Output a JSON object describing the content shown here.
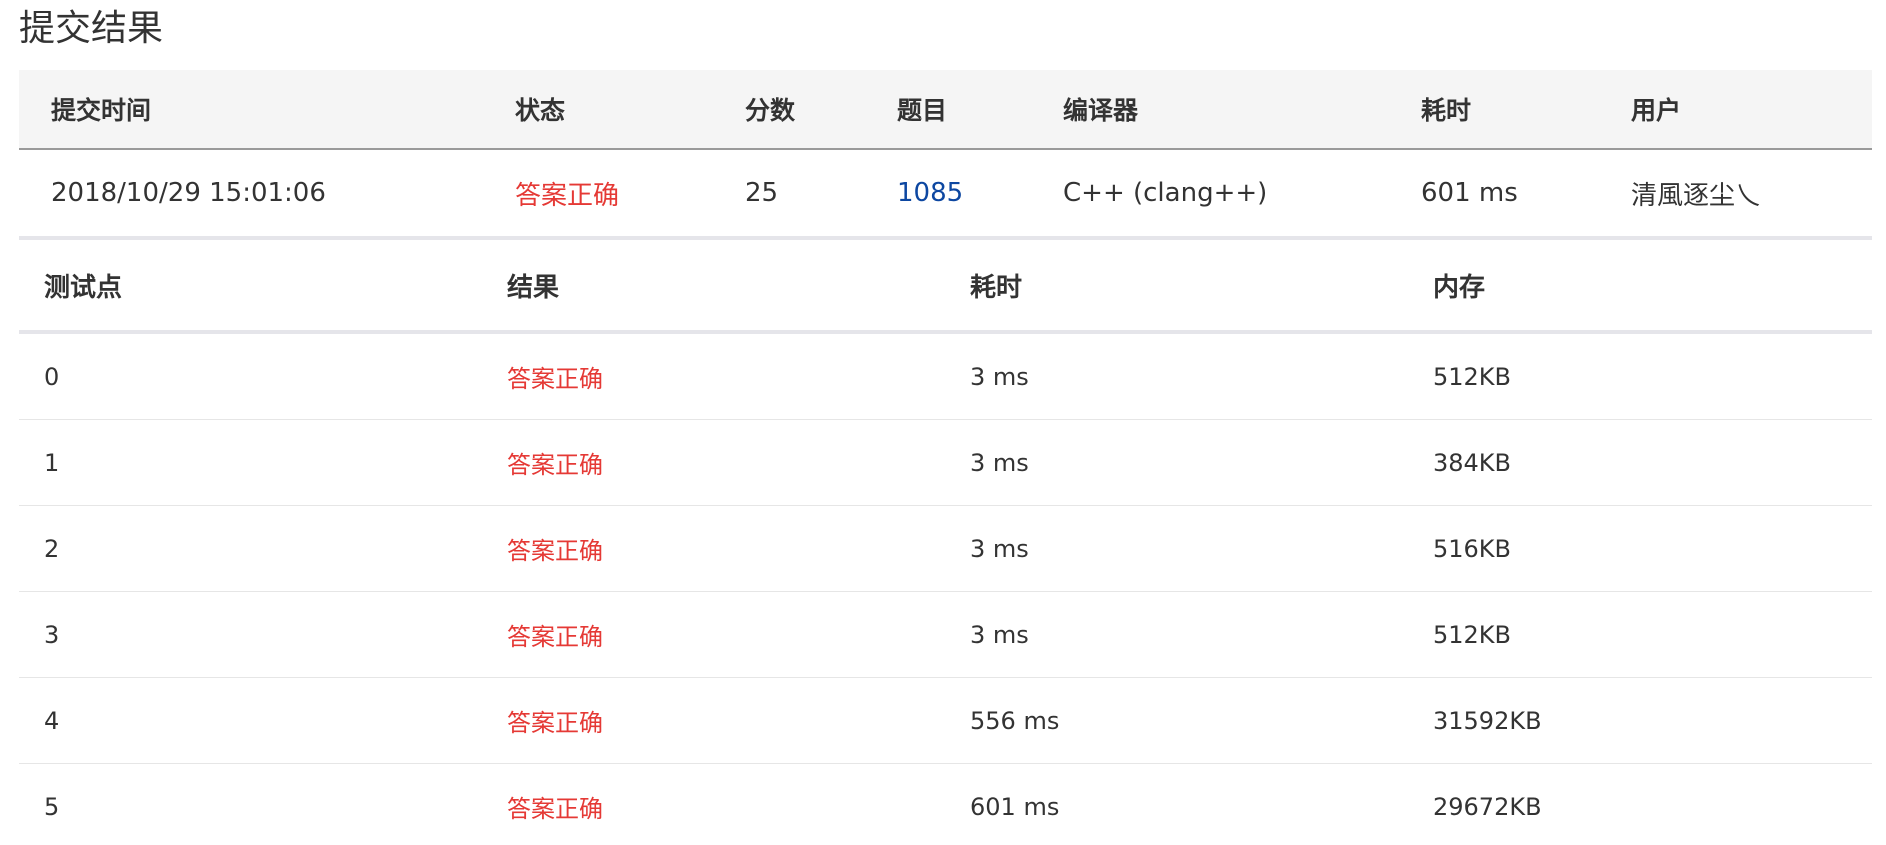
{
  "page_title": "提交结果",
  "submission": {
    "headers": [
      "提交时间",
      "状态",
      "分数",
      "题目",
      "编译器",
      "耗时",
      "用户"
    ],
    "row": {
      "time": "2018/10/29 15:01:06",
      "status": "答案正确",
      "score": "25",
      "problem": "1085",
      "compiler": "C++ (clang++)",
      "elapsed": "601 ms",
      "user": "清風逐尘乀"
    }
  },
  "test_cases": {
    "headers": [
      "测试点",
      "结果",
      "耗时",
      "内存"
    ],
    "rows": [
      {
        "id": "0",
        "result": "答案正确",
        "time": "3 ms",
        "memory": "512KB"
      },
      {
        "id": "1",
        "result": "答案正确",
        "time": "3 ms",
        "memory": "384KB"
      },
      {
        "id": "2",
        "result": "答案正确",
        "time": "3 ms",
        "memory": "516KB"
      },
      {
        "id": "3",
        "result": "答案正确",
        "time": "3 ms",
        "memory": "512KB"
      },
      {
        "id": "4",
        "result": "答案正确",
        "time": "556 ms",
        "memory": "31592KB"
      },
      {
        "id": "5",
        "result": "答案正确",
        "time": "601 ms",
        "memory": "29672KB"
      }
    ]
  },
  "colors": {
    "status_ok": "#e53935",
    "link": "#0d47a1",
    "header_bg": "#f5f5f5"
  }
}
